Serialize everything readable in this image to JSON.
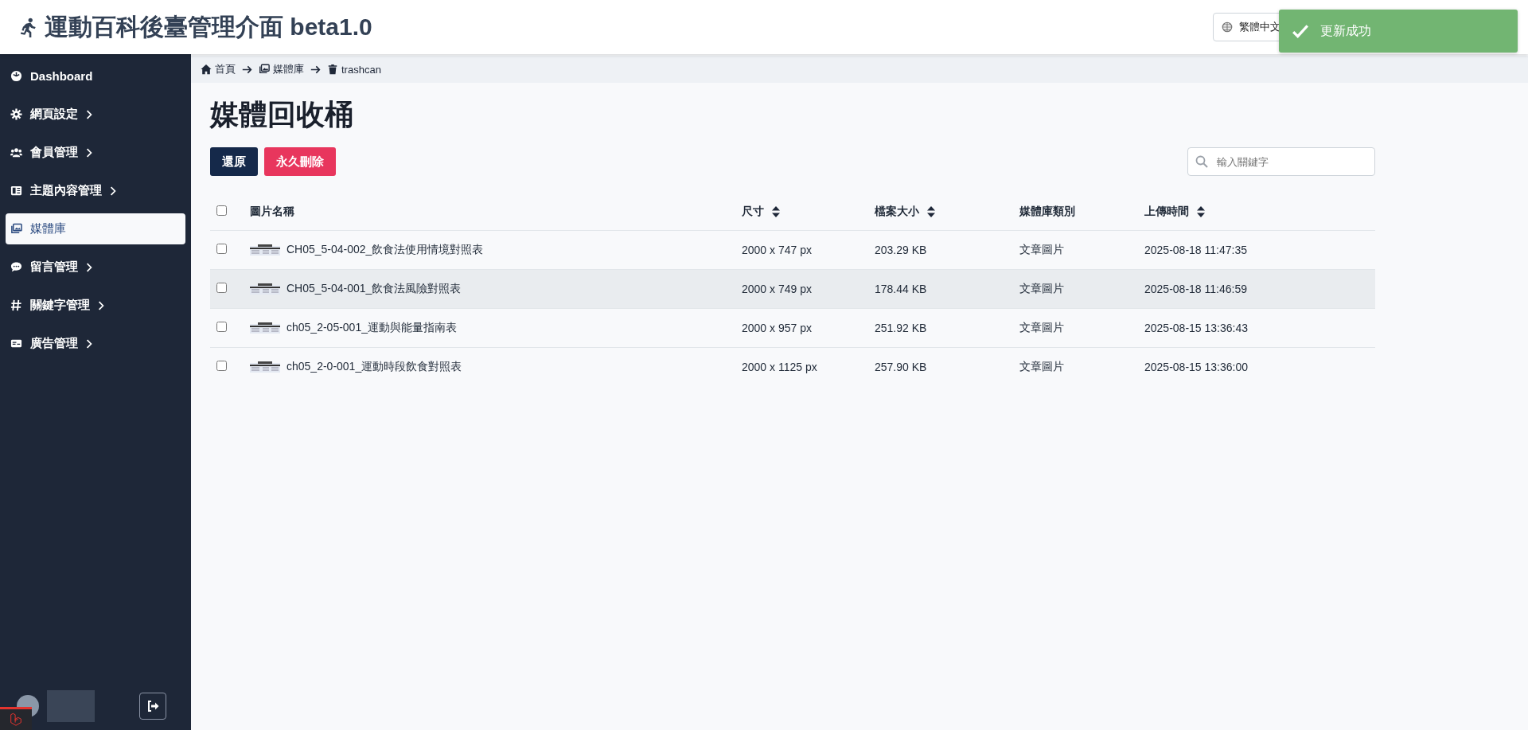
{
  "header": {
    "title": "運動百科後臺管理介面 beta1.0",
    "language": "繁體中文"
  },
  "toast": {
    "message": "更新成功"
  },
  "sidebar": {
    "items": [
      {
        "label": "Dashboard",
        "has_children": false,
        "selected": false
      },
      {
        "label": "網頁設定",
        "has_children": true,
        "selected": false
      },
      {
        "label": "會員管理",
        "has_children": true,
        "selected": false
      },
      {
        "label": "主題內容管理",
        "has_children": true,
        "selected": false
      },
      {
        "label": "媒體庫",
        "has_children": false,
        "selected": true
      },
      {
        "label": "留言管理",
        "has_children": true,
        "selected": false
      },
      {
        "label": "關鍵字管理",
        "has_children": true,
        "selected": false
      },
      {
        "label": "廣告管理",
        "has_children": true,
        "selected": false
      }
    ]
  },
  "breadcrumb": [
    {
      "label": "首頁"
    },
    {
      "label": "媒體庫"
    },
    {
      "label": "trashcan"
    }
  ],
  "page": {
    "title": "媒體回收桶"
  },
  "actions": [
    {
      "label": "還原",
      "kind": "primary"
    },
    {
      "label": "永久刪除",
      "kind": "danger"
    }
  ],
  "search": {
    "placeholder": "輸入關鍵字"
  },
  "table": {
    "all_checked": false,
    "columns": [
      {
        "label": "圖片名稱",
        "sortable": false
      },
      {
        "label": "尺寸",
        "sortable": true
      },
      {
        "label": "檔案大小",
        "sortable": true
      },
      {
        "label": "媒體庫類別",
        "sortable": false
      },
      {
        "label": "上傳時間",
        "sortable": true
      }
    ],
    "rows": [
      {
        "checked": false,
        "hovered": false,
        "name": "CH05_5-04-002_飲食法使用情境對照表",
        "size": "2000 x 747 px",
        "file_size": "203.29 KB",
        "category": "文章圖片",
        "uploaded": "2025-08-18 11:47:35"
      },
      {
        "checked": false,
        "hovered": true,
        "name": "CH05_5-04-001_飲食法風險對照表",
        "size": "2000 x 749 px",
        "file_size": "178.44 KB",
        "category": "文章圖片",
        "uploaded": "2025-08-18 11:46:59"
      },
      {
        "checked": false,
        "hovered": false,
        "name": "ch05_2-05-001_運動與能量指南表",
        "size": "2000 x 957 px",
        "file_size": "251.92 KB",
        "category": "文章圖片",
        "uploaded": "2025-08-15 13:36:43"
      },
      {
        "checked": false,
        "hovered": false,
        "name": "ch05_2-0-001_運動時段飲食對照表",
        "size": "2000 x 1125 px",
        "file_size": "257.90 KB",
        "category": "文章圖片",
        "uploaded": "2025-08-15 13:36:00"
      }
    ]
  }
}
